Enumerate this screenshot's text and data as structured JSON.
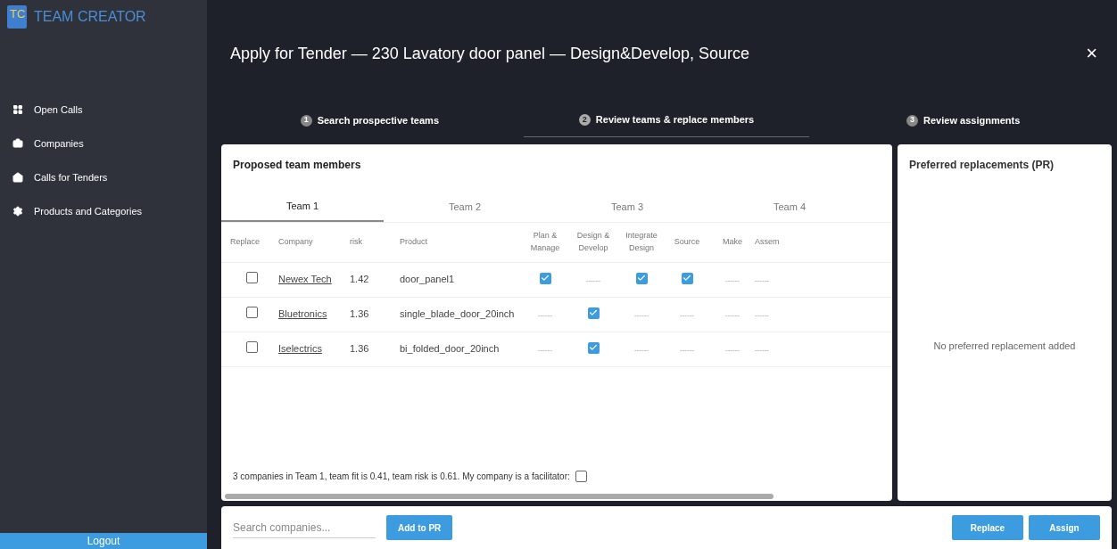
{
  "app": {
    "logo": "TC",
    "name": "TEAM CREATOR"
  },
  "sidebar": {
    "items": [
      {
        "label": "Open Calls",
        "kind": "grid"
      },
      {
        "label": "Companies",
        "kind": "briefcase"
      },
      {
        "label": "Calls for Tenders",
        "kind": "mail"
      },
      {
        "label": "Products and Categories",
        "kind": "gear"
      }
    ],
    "logout": "Logout"
  },
  "dialog": {
    "title": "Apply for Tender — 230 Lavatory door panel — Design&Develop, Source",
    "close": "×"
  },
  "steps": [
    {
      "number": "1",
      "label": "Search prospective teams",
      "selected": false
    },
    {
      "number": "2",
      "label": "Review teams & replace members",
      "selected": true
    },
    {
      "number": "3",
      "label": "Review assignments",
      "selected": false
    }
  ],
  "team_panel": {
    "title": "Proposed team members",
    "tabs": [
      {
        "label": "Team 1",
        "selected": true
      },
      {
        "label": "Team 2",
        "selected": false
      },
      {
        "label": "Team 3",
        "selected": false
      },
      {
        "label": "Team 4",
        "selected": false
      }
    ],
    "columns": [
      "Replace",
      "Company",
      "risk",
      "Product",
      "Plan & Manage",
      "Design & Develop",
      "Integrate Design",
      "Source",
      "Make",
      "Assem"
    ],
    "rows": [
      {
        "replace": false,
        "company": "Newex Tech",
        "risk": "1.42",
        "product": "door_panel1",
        "roles": [
          {
            "kind": "check",
            "checked": true
          },
          {
            "kind": "text",
            "text": "------"
          },
          {
            "kind": "check",
            "checked": true
          },
          {
            "kind": "check",
            "checked": true
          },
          {
            "kind": "text",
            "text": "------"
          },
          {
            "kind": "text",
            "text": "------"
          }
        ]
      },
      {
        "replace": false,
        "company": "Bluetronics",
        "risk": "1.36",
        "product": "single_blade_door_20inch",
        "roles": [
          {
            "kind": "text",
            "text": "------"
          },
          {
            "kind": "check",
            "checked": true
          },
          {
            "kind": "text",
            "text": "------"
          },
          {
            "kind": "text",
            "text": "------"
          },
          {
            "kind": "text",
            "text": "------"
          },
          {
            "kind": "text",
            "text": "------"
          }
        ]
      },
      {
        "replace": false,
        "company": "Iselectrics",
        "risk": "1.36",
        "product": "bi_folded_door_20inch",
        "roles": [
          {
            "kind": "text",
            "text": "------"
          },
          {
            "kind": "check",
            "checked": true
          },
          {
            "kind": "text",
            "text": "------"
          },
          {
            "kind": "text",
            "text": "------"
          },
          {
            "kind": "text",
            "text": "------"
          },
          {
            "kind": "text",
            "text": "------"
          }
        ]
      }
    ],
    "summary": "3 companies in Team 1, team fit is 0.41, team risk is 0.61. My company is a facilitator:",
    "facilitator": false
  },
  "pr_panel": {
    "title": "Preferred replacements (PR)",
    "empty": "No preferred replacement added"
  },
  "bottom": {
    "search_placeholder": "Search companies...",
    "add": "Add to PR",
    "replace": "Replace",
    "assign": "Assign"
  }
}
